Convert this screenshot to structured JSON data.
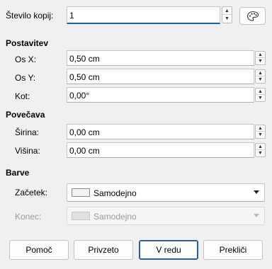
{
  "copies": {
    "label": "Število kopij:",
    "value": "1"
  },
  "placement": {
    "title": "Postavitev",
    "x": {
      "label": "Os X:",
      "value": "0,50 cm"
    },
    "y": {
      "label": "Os Y:",
      "value": "0,50 cm"
    },
    "angle": {
      "label": "Kot:",
      "value": "0,00°"
    }
  },
  "enlargement": {
    "title": "Povečava",
    "width": {
      "label": "Širina:",
      "value": "0,00 cm"
    },
    "height": {
      "label": "Višina:",
      "value": "0,00 cm"
    }
  },
  "colors": {
    "title": "Barve",
    "start": {
      "label": "Začetek:",
      "value": "Samodejno"
    },
    "end": {
      "label": "Konec:",
      "value": "Samodejno"
    }
  },
  "buttons": {
    "help": "Pomoč",
    "reset": "Privzeto",
    "ok": "V redu",
    "cancel": "Prekliči"
  }
}
